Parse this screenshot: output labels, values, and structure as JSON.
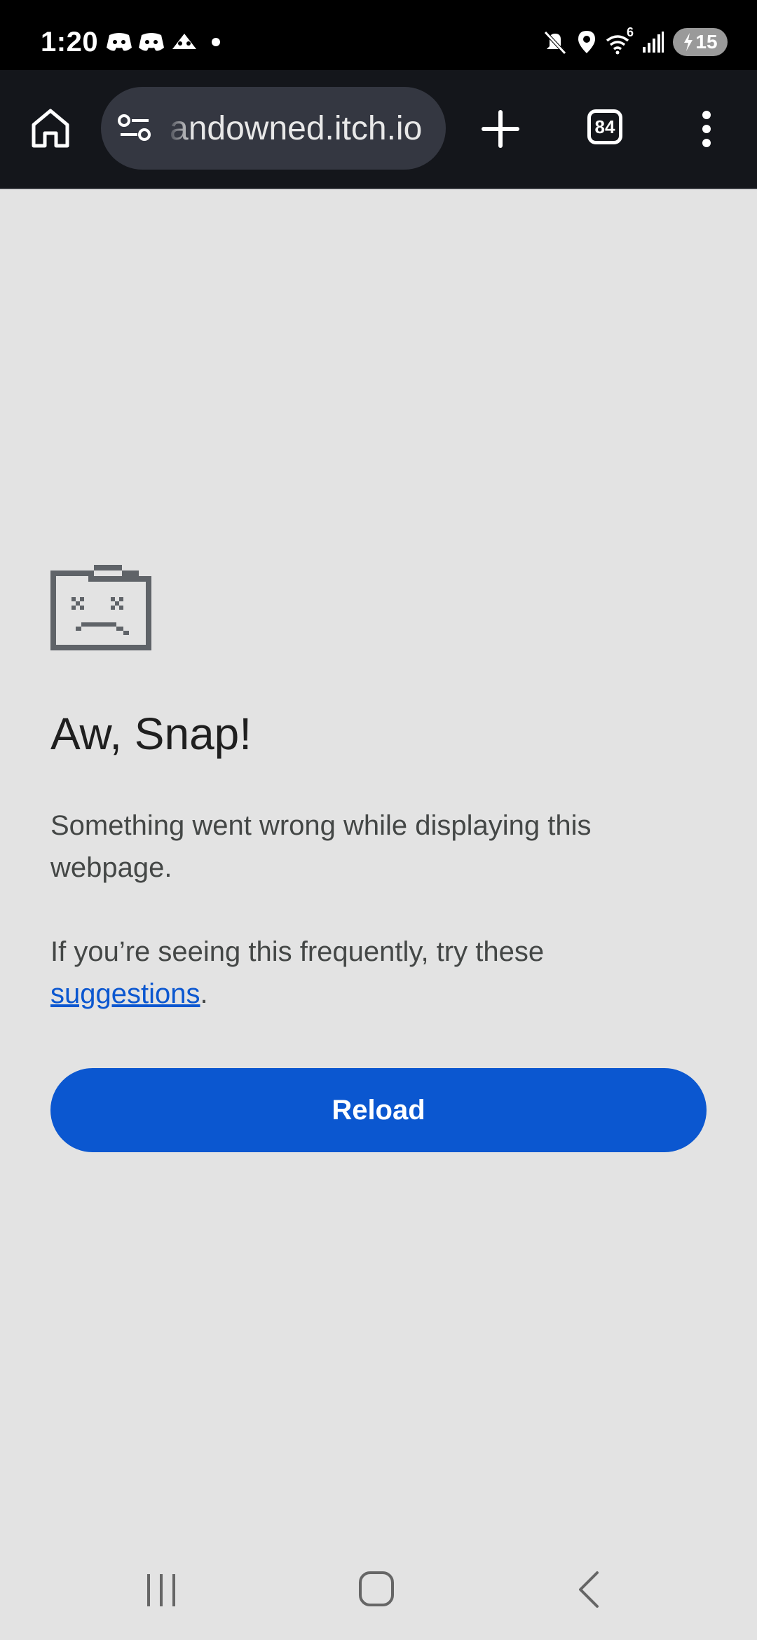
{
  "status_bar": {
    "time": "1:20",
    "notification_icons": [
      "discord-icon",
      "discord-icon",
      "game-icon",
      "dot-icon"
    ],
    "system_icons": [
      "mute-icon",
      "location-icon",
      "wifi-icon",
      "signal-icon"
    ],
    "wifi_badge": "6",
    "battery_level": "15",
    "charging": true
  },
  "toolbar": {
    "url": "andowned.itch.io",
    "tab_count": "84"
  },
  "error_page": {
    "title": "Aw, Snap!",
    "message": "Something went wrong while displaying this webpage.",
    "hint_prefix": "If you’re seeing this frequently, try these ",
    "hint_link": "suggestions",
    "hint_suffix": ".",
    "reload_label": "Reload"
  },
  "colors": {
    "accent": "#0b57d0",
    "page_background": "#e3e3e3",
    "toolbar_background": "#14161b"
  }
}
